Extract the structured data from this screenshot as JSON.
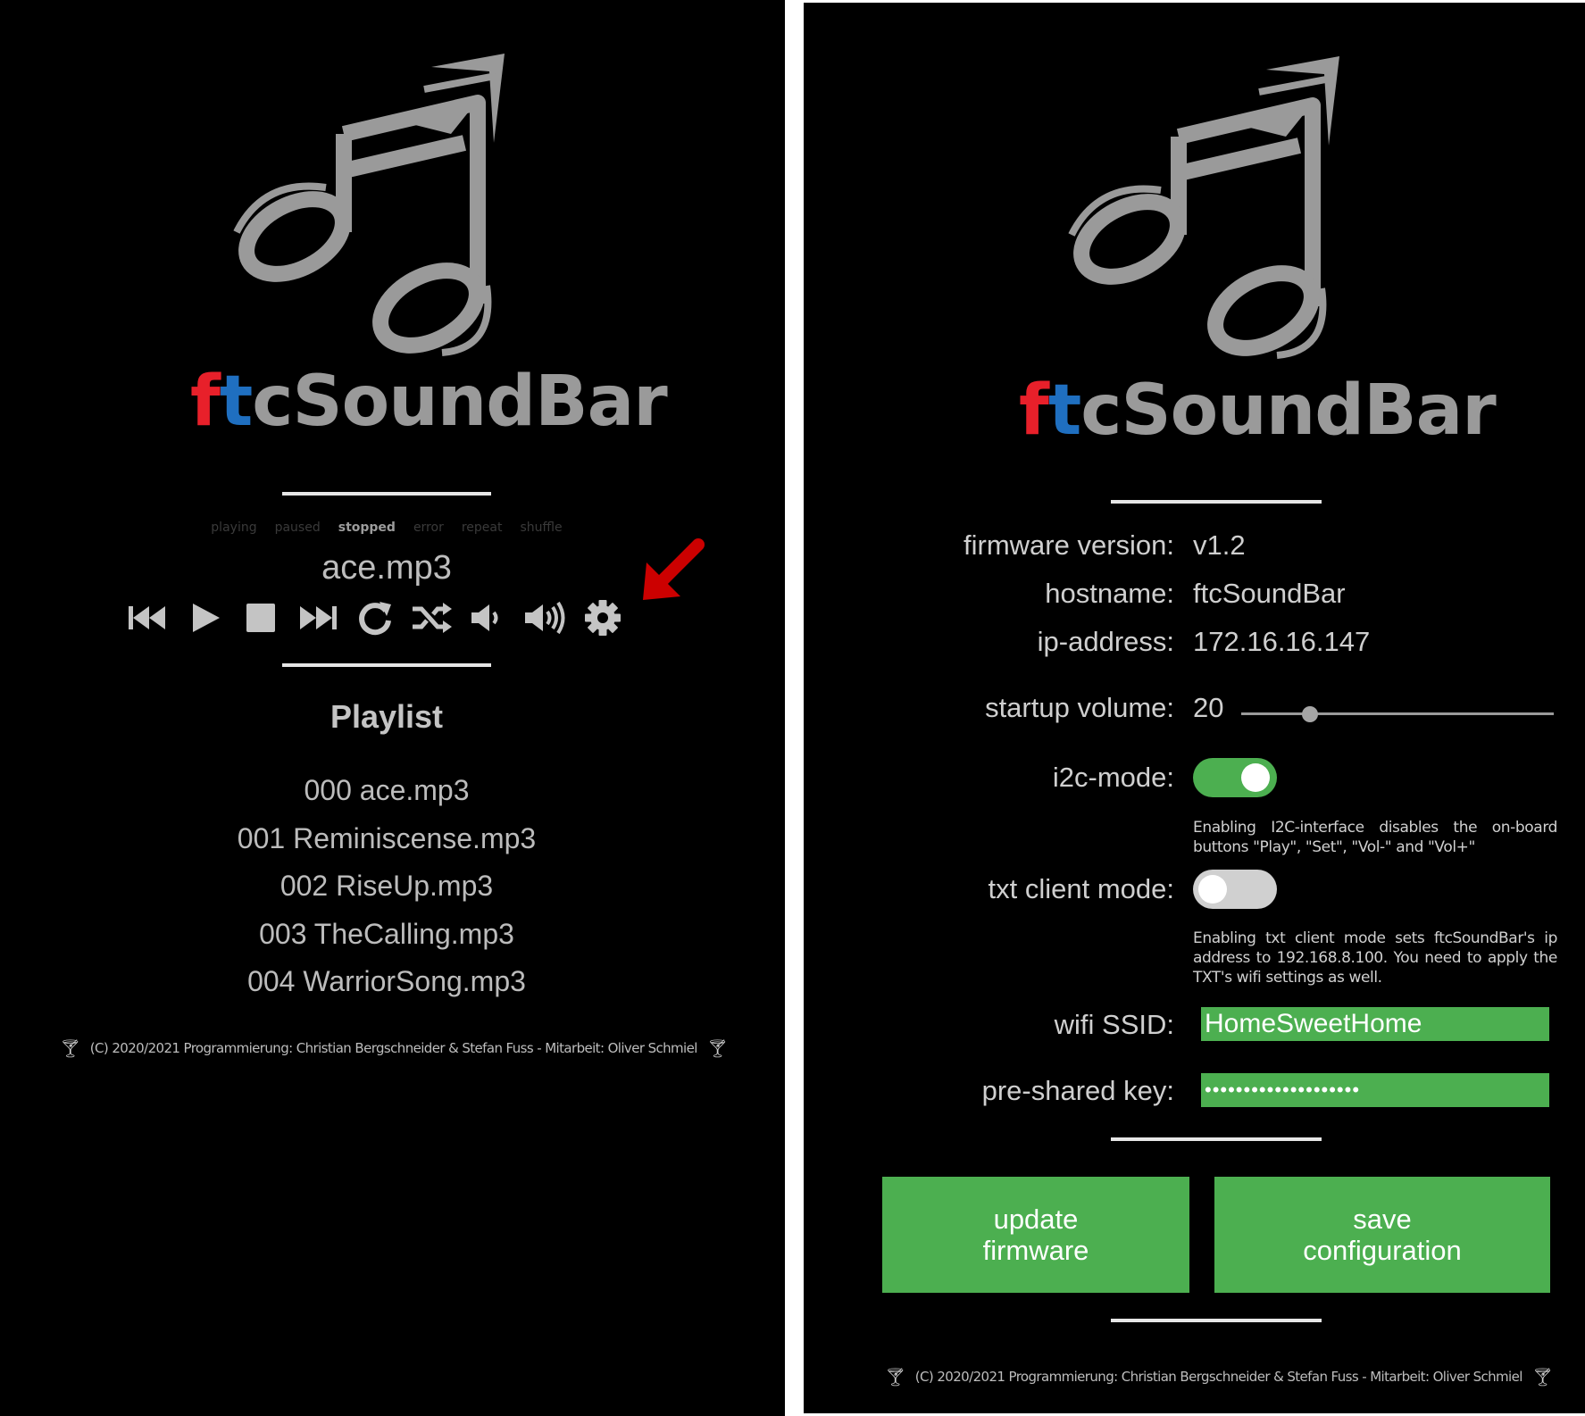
{
  "left": {
    "brand": {
      "f": "f",
      "t": "t",
      "rest": "cSoundBar"
    },
    "states": [
      {
        "label": "playing",
        "active": false
      },
      {
        "label": "paused",
        "active": false
      },
      {
        "label": "stopped",
        "active": true
      },
      {
        "label": "error",
        "active": false
      },
      {
        "label": "repeat",
        "active": false
      },
      {
        "label": "shuffle",
        "active": false
      }
    ],
    "current_track": "ace.mp3",
    "controls": [
      "skip-back-icon",
      "play-icon",
      "stop-icon",
      "skip-forward-icon",
      "repeat-icon",
      "shuffle-icon",
      "volume-down-icon",
      "volume-up-icon",
      "settings-icon"
    ],
    "playlist_title": "Playlist",
    "playlist": [
      "000 ace.mp3",
      "001 Reminiscense.mp3",
      "002 RiseUp.mp3",
      "003 TheCalling.mp3",
      "004 WarriorSong.mp3"
    ],
    "footer": "(C) 2020/2021 Programmierung: Christian Bergschneider & Stefan Fuss - Mitarbeit: Oliver Schmiel",
    "arrow_color": "#cc0000"
  },
  "right": {
    "brand": {
      "f": "f",
      "t": "t",
      "rest": "cSoundBar"
    },
    "firmware_label": "firmware version:",
    "firmware_value": "v1.2",
    "hostname_label": "hostname:",
    "hostname_value": "ftcSoundBar",
    "ip_label": "ip-address:",
    "ip_value": "172.16.16.147",
    "volume_label": "startup volume:",
    "volume_value": "20",
    "volume_fraction": 0.22,
    "i2c_label": "i2c-mode:",
    "i2c_on": true,
    "i2c_hint": "Enabling I2C-interface disables the on-board buttons \"Play\", \"Set\", \"Vol-\" and \"Vol+\"",
    "txt_label": "txt client mode:",
    "txt_on": false,
    "txt_hint": "Enabling txt client mode sets ftcSoundBar's ip address to 192.168.8.100. You need to apply the TXT's wifi settings as well.",
    "ssid_label": "wifi SSID:",
    "ssid_value": "HomeSweetHome",
    "psk_label": "pre-shared key:",
    "psk_value": "••••••••••••••••••••",
    "update_button": "update\nfirmware",
    "save_button": "save\nconfiguration",
    "footer": "(C) 2020/2021 Programmierung: Christian Bergschneider & Stefan Fuss - Mitarbeit: Oliver Schmiel",
    "accent": "#4caf50"
  }
}
